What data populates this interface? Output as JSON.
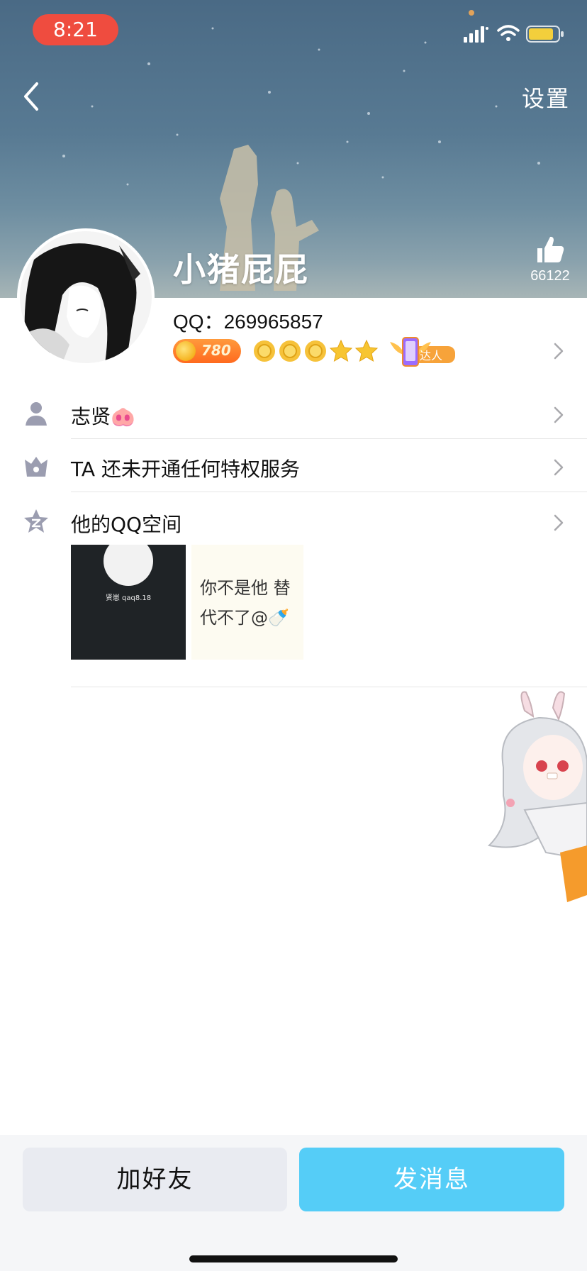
{
  "status_bar": {
    "time": "8:21"
  },
  "nav": {
    "settings_label": "设置"
  },
  "profile": {
    "name": "小猪屁屁",
    "qq_label": "QQ：",
    "qq_number": "269965857",
    "likes": "66122",
    "level_number": "780",
    "talent_label": "达人"
  },
  "rows": {
    "remark_label": "志贤🐽",
    "privilege_label": "TA 还未开通任何特权服务",
    "qzone_label": "他的QQ空间"
  },
  "qzone": {
    "thumb_dark_caption": "贤崽 qaq8.18",
    "thumb_text_line1": "你不是他 替",
    "thumb_text_line2": "代不了@🍼"
  },
  "actions": {
    "add_friend_label": "加好友",
    "send_message_label": "发消息"
  },
  "colors": {
    "send_button": "#55cdf7",
    "add_button": "#e9ebf1",
    "status_time_bg": "#ef4c3f"
  }
}
